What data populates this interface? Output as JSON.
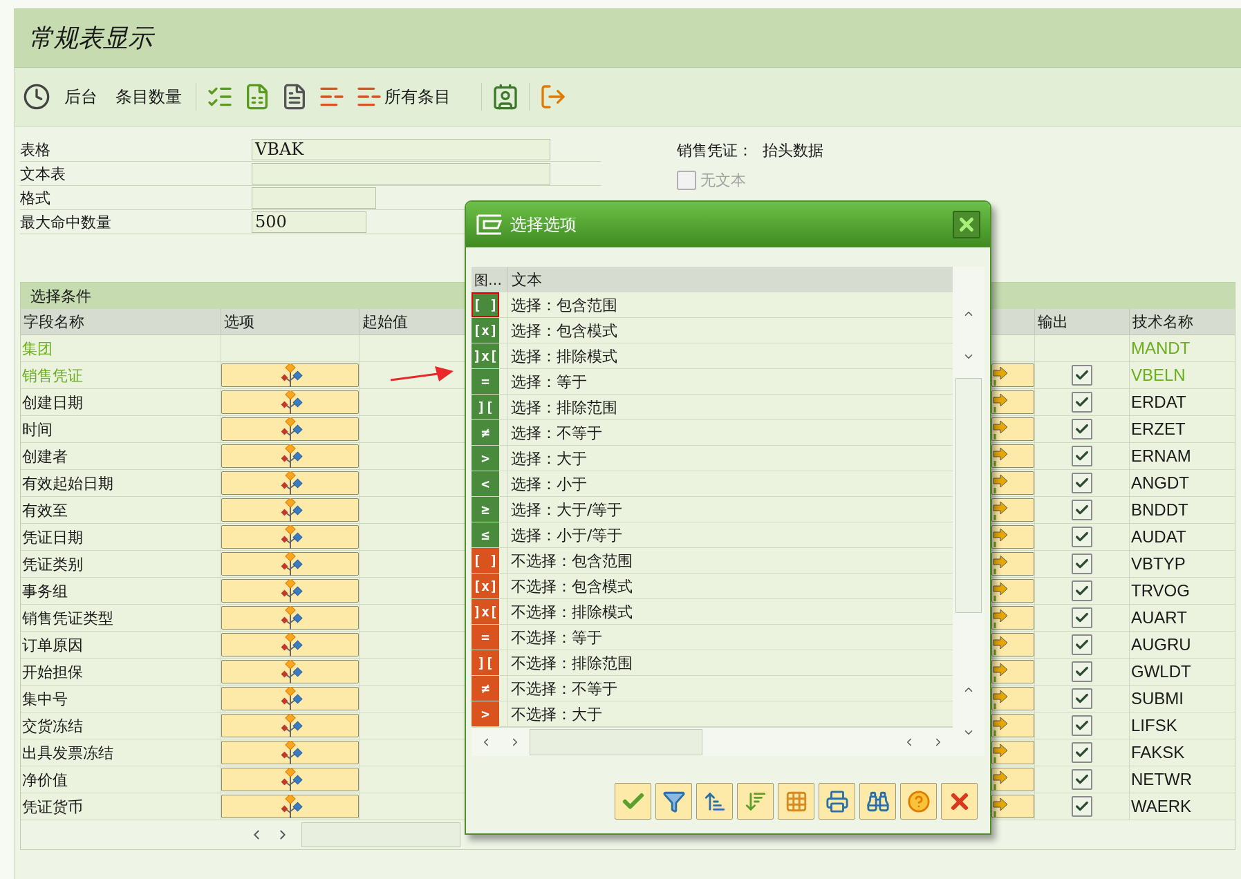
{
  "window": {
    "title": "常规表显示"
  },
  "toolbar": [
    {
      "label": "后台"
    },
    {
      "label": "条目数量"
    },
    {
      "label": "所有条目"
    }
  ],
  "form": {
    "fields": [
      {
        "label": "表格",
        "value": "VBAK",
        "kind": "long"
      },
      {
        "label": "文本表",
        "kind": "long"
      },
      {
        "label": "格式",
        "kind": "medium"
      },
      {
        "label": "最大命中数量",
        "value": "500",
        "kind": "short"
      }
    ],
    "description": "销售凭证：  抬头数据",
    "no_text_checkbox": {
      "label": "无文本",
      "checked": false,
      "disabled": true
    }
  },
  "selection": {
    "title": "选择条件",
    "columns": [
      "字段名称",
      "选项",
      "起始值",
      "输出",
      "技术名称"
    ],
    "rows": [
      {
        "field": "集团",
        "key": true,
        "option_button": false,
        "output_checkbox": false,
        "tech_name": "MANDT"
      },
      {
        "field": "销售凭证",
        "key": true,
        "option_button": true,
        "output_checkbox": true,
        "checked": true,
        "tech_name": "VBELN"
      },
      {
        "field": "创建日期",
        "key": false,
        "option_button": true,
        "output_checkbox": true,
        "checked": true,
        "tech_name": "ERDAT"
      },
      {
        "field": "时间",
        "key": false,
        "option_button": true,
        "output_checkbox": true,
        "checked": true,
        "tech_name": "ERZET"
      },
      {
        "field": "创建者",
        "key": false,
        "option_button": true,
        "output_checkbox": true,
        "checked": true,
        "tech_name": "ERNAM"
      },
      {
        "field": "有效起始日期",
        "key": false,
        "option_button": true,
        "output_checkbox": true,
        "checked": true,
        "tech_name": "ANGDT"
      },
      {
        "field": "有效至",
        "key": false,
        "option_button": true,
        "output_checkbox": true,
        "checked": true,
        "tech_name": "BNDDT"
      },
      {
        "field": "凭证日期",
        "key": false,
        "option_button": true,
        "output_checkbox": true,
        "checked": true,
        "tech_name": "AUDAT"
      },
      {
        "field": "凭证类别",
        "key": false,
        "option_button": true,
        "output_checkbox": true,
        "checked": true,
        "tech_name": "VBTYP"
      },
      {
        "field": "事务组",
        "key": false,
        "option_button": true,
        "output_checkbox": true,
        "checked": true,
        "tech_name": "TRVOG"
      },
      {
        "field": "销售凭证类型",
        "key": false,
        "option_button": true,
        "output_checkbox": true,
        "checked": true,
        "tech_name": "AUART"
      },
      {
        "field": "订单原因",
        "key": false,
        "option_button": true,
        "output_checkbox": true,
        "checked": true,
        "tech_name": "AUGRU"
      },
      {
        "field": "开始担保",
        "key": false,
        "option_button": true,
        "output_checkbox": true,
        "checked": true,
        "tech_name": "GWLDT"
      },
      {
        "field": "集中号",
        "key": false,
        "option_button": true,
        "output_checkbox": true,
        "checked": true,
        "tech_name": "SUBMI"
      },
      {
        "field": "交货冻结",
        "key": false,
        "option_button": true,
        "output_checkbox": true,
        "checked": true,
        "tech_name": "LIFSK"
      },
      {
        "field": "出具发票冻结",
        "key": false,
        "option_button": true,
        "output_checkbox": true,
        "checked": true,
        "tech_name": "FAKSK"
      },
      {
        "field": "净价值",
        "key": false,
        "option_button": true,
        "output_checkbox": true,
        "checked": true,
        "tech_name": "NETWR"
      },
      {
        "field": "凭证货币",
        "key": false,
        "option_button": true,
        "output_checkbox": true,
        "checked": true,
        "tech_name": "WAERK"
      }
    ]
  },
  "dialog": {
    "title": "选择选项",
    "columns": [
      "图…",
      "文本"
    ],
    "options": [
      {
        "kind": "include",
        "symbol": "[ ]",
        "text": "选择：包含范围",
        "selected": true
      },
      {
        "kind": "include",
        "symbol": "[x]",
        "text": "选择：包含模式",
        "selected": false
      },
      {
        "kind": "include",
        "symbol": "]x[",
        "text": "选择：排除模式",
        "selected": false
      },
      {
        "kind": "include",
        "symbol": "=",
        "text": "选择：等于",
        "selected": false
      },
      {
        "kind": "include",
        "symbol": "][",
        "text": "选择：排除范围",
        "selected": false
      },
      {
        "kind": "include",
        "symbol": "≠",
        "text": "选择：不等于",
        "selected": false
      },
      {
        "kind": "include",
        "symbol": ">",
        "text": "选择：大于",
        "selected": false
      },
      {
        "kind": "include",
        "symbol": "<",
        "text": "选择：小于",
        "selected": false
      },
      {
        "kind": "include",
        "symbol": "≥",
        "text": "选择：大于/等于",
        "selected": false
      },
      {
        "kind": "include",
        "symbol": "≤",
        "text": "选择：小于/等于",
        "selected": false
      },
      {
        "kind": "exclude",
        "symbol": "[ ]",
        "text": "不选择：包含范围",
        "selected": false
      },
      {
        "kind": "exclude",
        "symbol": "[x]",
        "text": "不选择：包含模式",
        "selected": false
      },
      {
        "kind": "exclude",
        "symbol": "]x[",
        "text": "不选择：排除模式",
        "selected": false
      },
      {
        "kind": "exclude",
        "symbol": "=",
        "text": "不选择：等于",
        "selected": false
      },
      {
        "kind": "exclude",
        "symbol": "][",
        "text": "不选择：排除范围",
        "selected": false
      },
      {
        "kind": "exclude",
        "symbol": "≠",
        "text": "不选择：不等于",
        "selected": false
      },
      {
        "kind": "exclude",
        "symbol": ">",
        "text": "不选择：大于",
        "selected": false
      }
    ]
  }
}
